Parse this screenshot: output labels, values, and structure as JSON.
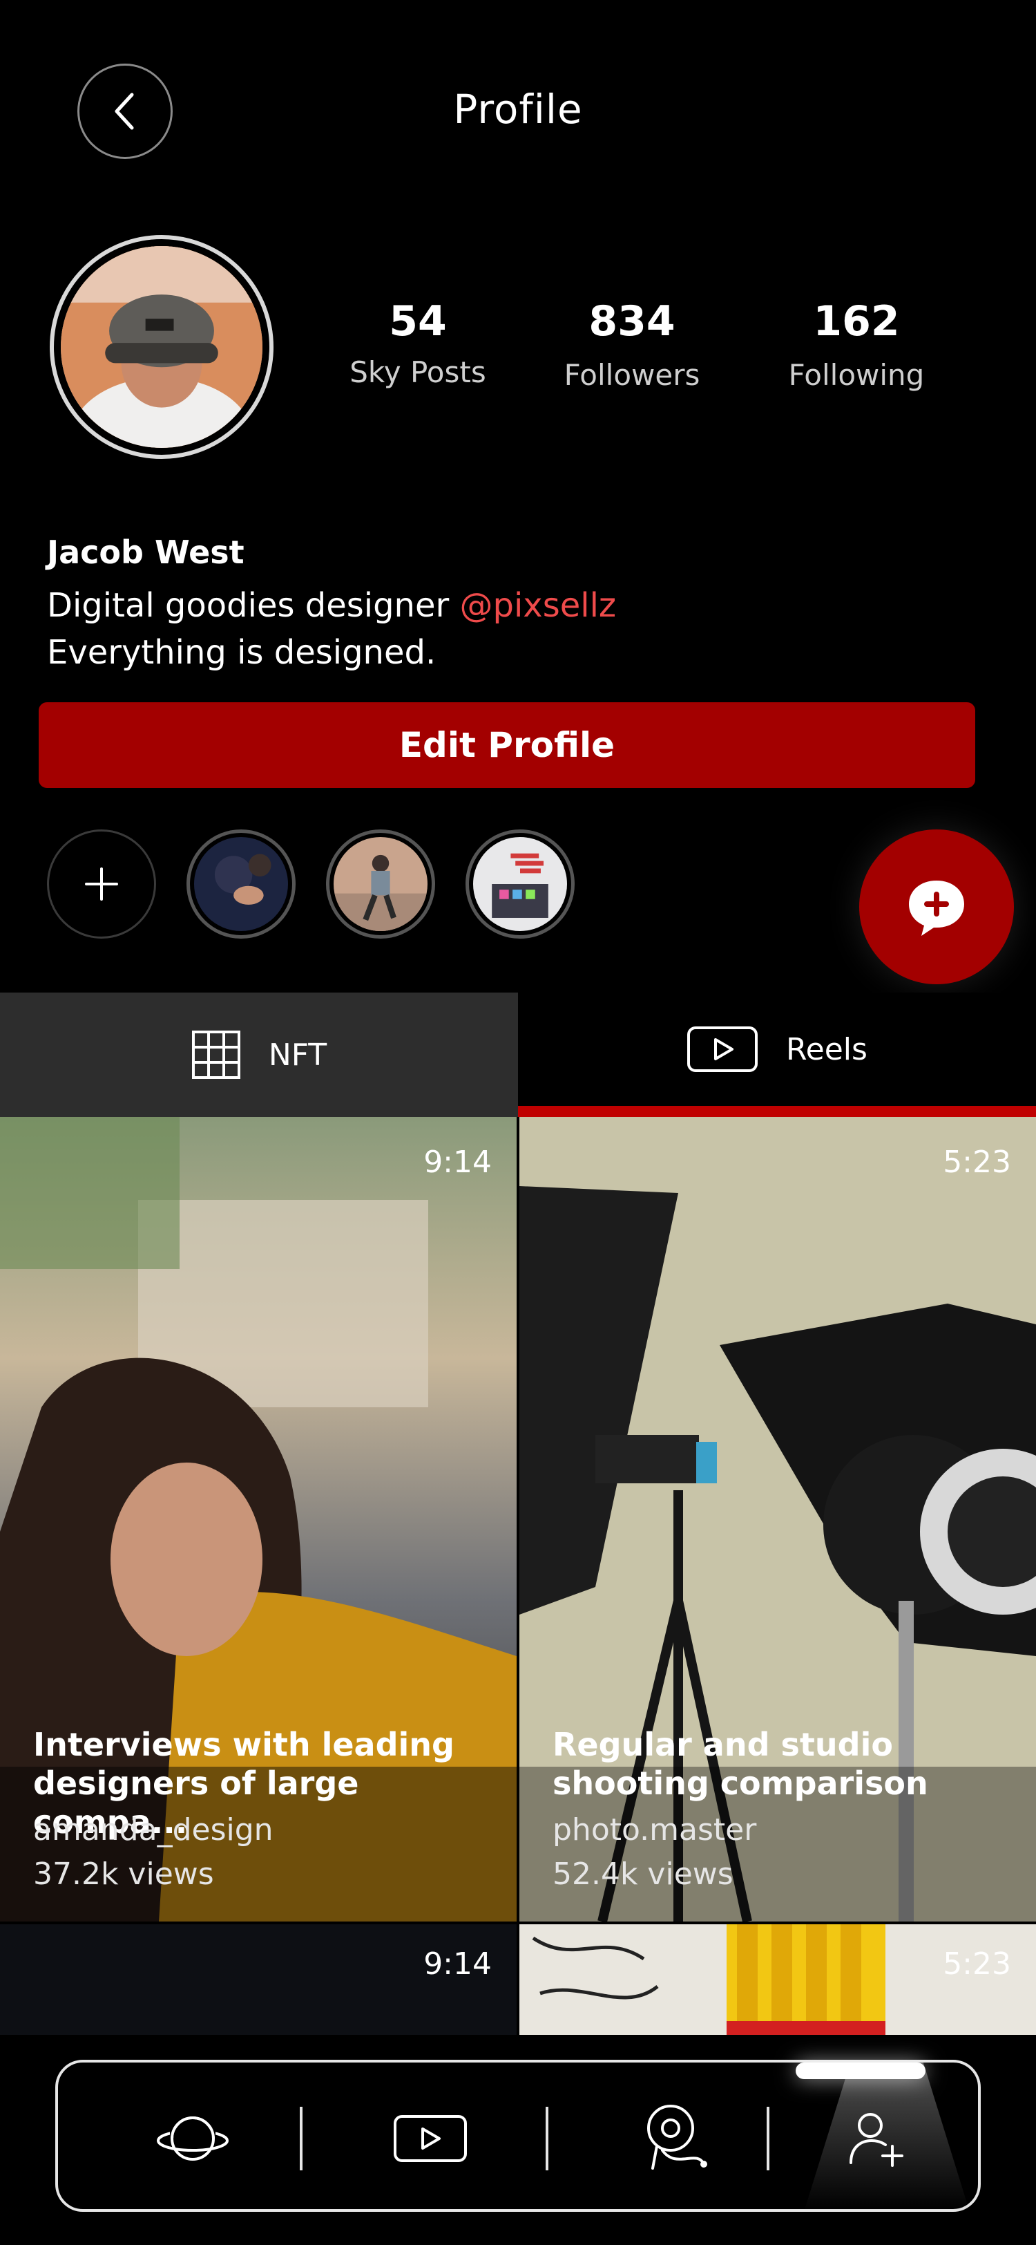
{
  "header": {
    "title": "Profile"
  },
  "profile": {
    "name": "Jacob West",
    "bio_line1": "Digital goodies designer ",
    "mention": "@pixsellz",
    "bio_line2": "Everything is designed.",
    "edit_label": "Edit Profile"
  },
  "stats": [
    {
      "value": "54",
      "label": "Sky Posts"
    },
    {
      "value": "834",
      "label": "Followers"
    },
    {
      "value": "162",
      "label": "Following"
    }
  ],
  "tabs": [
    {
      "label": "NFT",
      "icon": "grid-icon",
      "active": false
    },
    {
      "label": "Reels",
      "icon": "reels-icon",
      "active": true
    }
  ],
  "posts": [
    {
      "duration": "9:14",
      "title_line1": "Interviews with leading",
      "title_line2": "designers of large compa...",
      "user": "amanda_design",
      "views": "37.2k views"
    },
    {
      "duration": "5:23",
      "title_line1": "Regular and studio",
      "title_line2": "shooting comparison",
      "user": "photo.master",
      "views": "52.4k views"
    },
    {
      "duration": "9:14"
    },
    {
      "duration": "5:23"
    }
  ],
  "nav": [
    {
      "icon": "planet-icon"
    },
    {
      "icon": "video-icon"
    },
    {
      "icon": "location-route-icon"
    },
    {
      "icon": "add-user-icon",
      "active": true
    }
  ],
  "colors": {
    "accent": "#a30000",
    "mention": "#ef4b4b",
    "tab_active": "#c00000"
  }
}
